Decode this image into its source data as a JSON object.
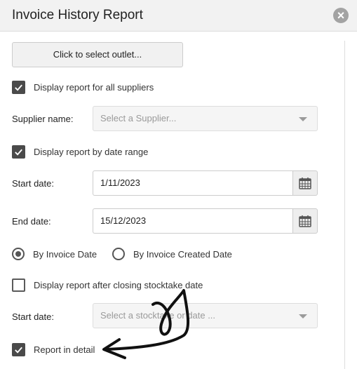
{
  "dialog": {
    "title": "Invoice History Report",
    "close_label": "×"
  },
  "outlet_button": {
    "label": "Click to select outlet..."
  },
  "all_suppliers": {
    "label": "Display report for all suppliers",
    "checked": true
  },
  "supplier": {
    "label": "Supplier name:",
    "placeholder": "Select a Supplier..."
  },
  "date_range": {
    "label": "Display report by date range",
    "checked": true
  },
  "start_date": {
    "label": "Start date:",
    "value": "1/11/2023"
  },
  "end_date": {
    "label": "End date:",
    "value": "15/12/2023"
  },
  "date_type": {
    "options": [
      {
        "label": "By Invoice Date",
        "selected": true
      },
      {
        "label": "By Invoice Created Date",
        "selected": false
      }
    ]
  },
  "after_stocktake": {
    "label": "Display report after closing stocktake date",
    "checked": false
  },
  "stocktake_start": {
    "label": "Start date:",
    "placeholder": "Select a stocktake or date ..."
  },
  "report_detail": {
    "label": "Report in detail",
    "checked": true
  },
  "icons": {
    "close": "close-icon",
    "calendar": "calendar-icon",
    "check": "check-icon",
    "dropdown": "chevron-down-icon"
  },
  "colors": {
    "checkbox_fill": "#4a4a4a",
    "header_bg": "#f2f2f2",
    "close_bg": "#a3a3a3"
  }
}
